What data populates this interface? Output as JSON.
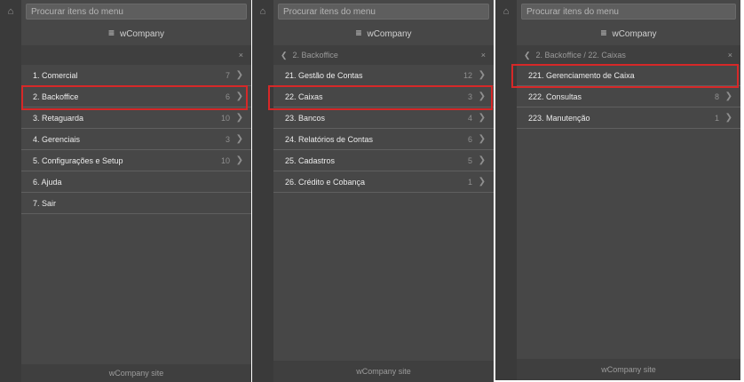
{
  "panels": [
    {
      "search_placeholder": "Procurar itens do menu",
      "brand": "wCompany",
      "breadcrumb": "",
      "close_label": "×",
      "items": [
        {
          "label": "1. Comercial",
          "count": "7"
        },
        {
          "label": "2. Backoffice",
          "count": "6"
        },
        {
          "label": "3. Retaguarda",
          "count": "10"
        },
        {
          "label": "4. Gerenciais",
          "count": "3"
        },
        {
          "label": "5. Configurações e Setup",
          "count": "10"
        },
        {
          "label": "6. Ajuda",
          "count": ""
        },
        {
          "label": "7. Sair",
          "count": ""
        }
      ],
      "footer": "wCompany site"
    },
    {
      "search_placeholder": "Procurar itens do menu",
      "brand": "wCompany",
      "breadcrumb": "2. Backoffice",
      "close_label": "×",
      "items": [
        {
          "label": "21. Gestão de Contas",
          "count": "12"
        },
        {
          "label": "22. Caixas",
          "count": "3"
        },
        {
          "label": "23. Bancos",
          "count": "4"
        },
        {
          "label": "24. Relatórios de Contas",
          "count": "6"
        },
        {
          "label": "25. Cadastros",
          "count": "5"
        },
        {
          "label": "26. Crédito e Cobança",
          "count": "1"
        }
      ],
      "footer": "wCompany site"
    },
    {
      "search_placeholder": "Procurar itens do menu",
      "brand": "wCompany",
      "breadcrumb": "2. Backoffice / 22. Caixas",
      "close_label": "×",
      "items": [
        {
          "label": "221. Gerenciamento de Caixa",
          "count": ""
        },
        {
          "label": "222. Consultas",
          "count": "8"
        },
        {
          "label": "223. Manutenção",
          "count": "1"
        }
      ],
      "footer": "wCompany site"
    }
  ]
}
